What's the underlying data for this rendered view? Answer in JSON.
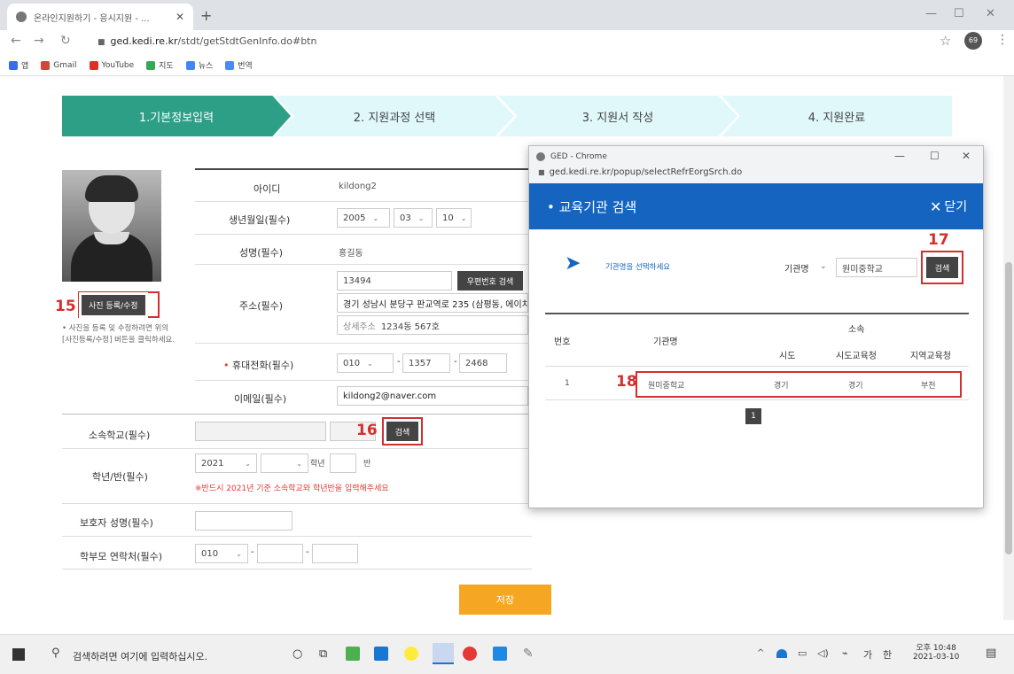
{
  "browser": {
    "tab_title": "온라인지원하기 - 응시지원 - ...",
    "url_host": "ged.kedi.re.kr",
    "url_path": "/stdt/getStdtGenInfo.do#btn",
    "profile": "69",
    "bookmarks": [
      "앱",
      "Gmail",
      "YouTube",
      "지도",
      "뉴스",
      "번역"
    ]
  },
  "steps": [
    "1.기본정보입력",
    "2. 지원과정 선택",
    "3. 지원서 작성",
    "4. 지원완료"
  ],
  "photo": {
    "button": "사진 등록/수정",
    "marker": "15",
    "note": "• 사진을 등록 및 수정하려면 위의 [사진등록/수정] 버튼을 클릭하세요."
  },
  "form": {
    "id_label": "아이디",
    "id_value": "kildong2",
    "birth_label": "생년월일(필수)",
    "birth_year": "2005",
    "birth_month": "03",
    "birth_day": "10",
    "name_label": "성명(필수)",
    "name_value": "홍길동",
    "addr_label": "주소(필수)",
    "zipcode": "13494",
    "zip_button": "우편번호 검색",
    "address1": "경기 성남시 분당구 판교역로 235 (삼평동, 에이치",
    "address2_prefix": "상세주소",
    "address2": "1234동 567호",
    "phone_label": "휴대전화(필수)",
    "phone1": "010",
    "phone2": "1357",
    "phone3": "2468",
    "email_label": "이메일(필수)",
    "email_value": "kildong2@naver.com",
    "school_label": "소속학교(필수)",
    "school_search": "검색",
    "school_marker": "16",
    "grade_label": "학년/반(필수)",
    "grade_year": "2021",
    "grade_unit": "학년",
    "class_unit": "반",
    "grade_note": "※반드시 2021년 기준 소속학교와 학년반을 입력해주세요",
    "guardian_label": "보호자 성명(필수)",
    "parent_phone_label": "학부모 연락처(필수)",
    "parent_phone1": "010",
    "save_button": "저장"
  },
  "popup": {
    "window_title": "GED - Chrome",
    "url": "ged.kedi.re.kr/popup/selectRefrEorgSrch.do",
    "title": "• 교육기관 검색",
    "close_label": "닫기",
    "instruction": "기관명을 선택하세요",
    "search_field_label": "기관명",
    "search_value": "원미중학교",
    "search_button": "검색",
    "search_marker": "17",
    "table": {
      "col_no": "번호",
      "col_name": "기관명",
      "col_affil": "소속",
      "col_sido": "시도",
      "col_office": "시도교육청",
      "col_region": "지역교육청"
    },
    "rows": [
      {
        "no": "1",
        "name": "원미중학교",
        "sido": "경기",
        "office": "경기",
        "region": "부천"
      }
    ],
    "row_marker": "18",
    "page": "1"
  },
  "taskbar": {
    "search_placeholder": "검색하려면 여기에 입력하십시오.",
    "ime": "가",
    "lang": "한",
    "time": "오후 10:48",
    "date": "2021-03-10"
  }
}
